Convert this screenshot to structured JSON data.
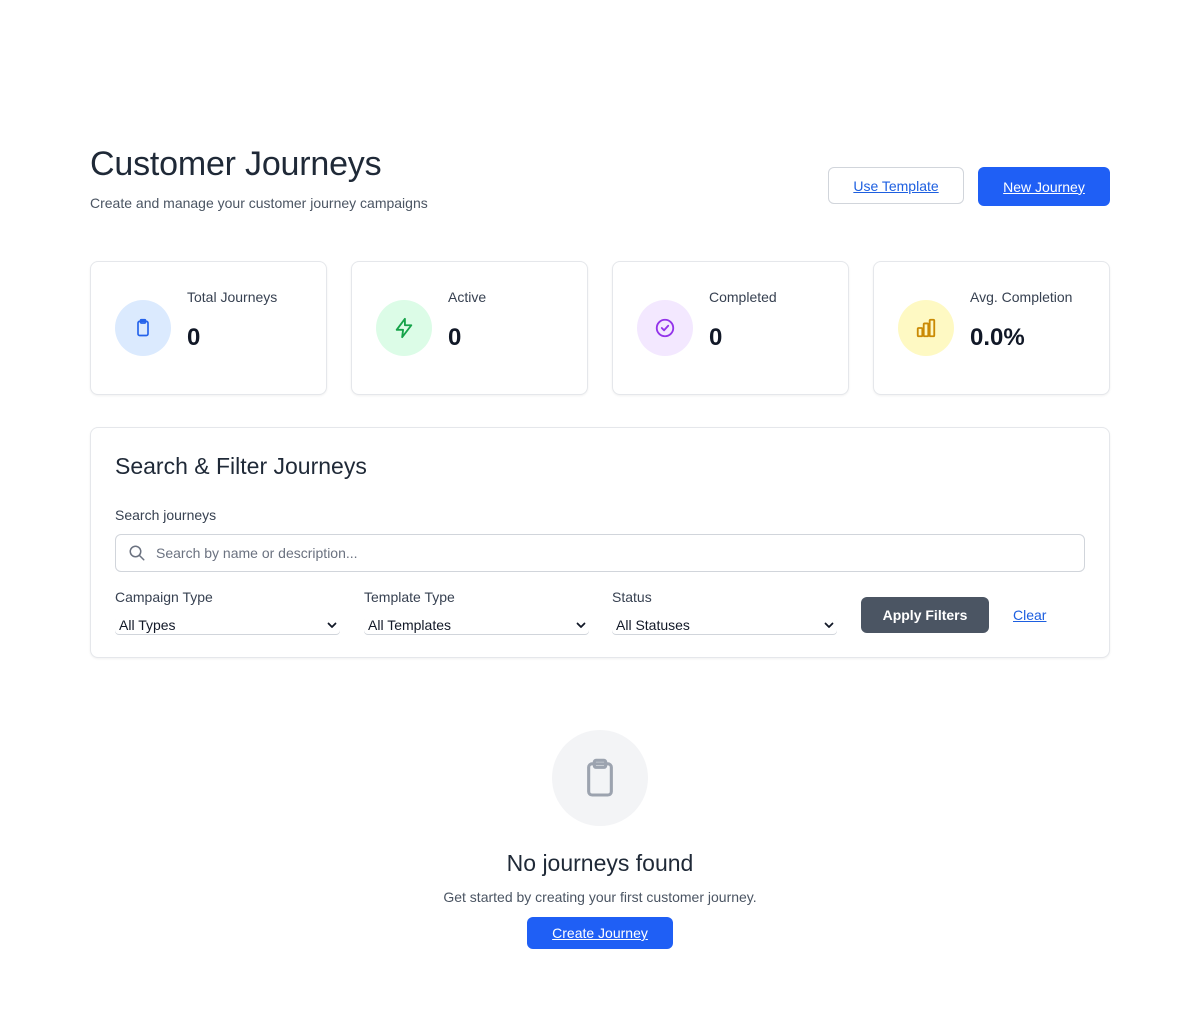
{
  "header": {
    "title": "Customer Journeys",
    "subtitle": "Create and manage your customer journey campaigns",
    "use_template_label": "Use Template",
    "new_journey_label": "New Journey"
  },
  "stats": [
    {
      "label": "Total Journeys",
      "value": "0",
      "icon": "clipboard-icon",
      "color": "#2563eb",
      "bg": "#dbeafe"
    },
    {
      "label": "Active",
      "value": "0",
      "icon": "lightning-icon",
      "color": "#16a34a",
      "bg": "#dcfce7"
    },
    {
      "label": "Completed",
      "value": "0",
      "icon": "check-circle-icon",
      "color": "#9333ea",
      "bg": "#f3e8ff"
    },
    {
      "label": "Avg. Completion",
      "value": "0.0%",
      "icon": "bar-chart-icon",
      "color": "#ca8a04",
      "bg": "#fef9c3"
    }
  ],
  "filters": {
    "title": "Search & Filter Journeys",
    "search_label": "Search journeys",
    "search_placeholder": "Search by name or description...",
    "campaign_type_label": "Campaign Type",
    "campaign_type_value": "All Types",
    "template_type_label": "Template Type",
    "template_type_value": "All Templates",
    "status_label": "Status",
    "status_value": "All Statuses",
    "apply_label": "Apply Filters",
    "clear_label": "Clear"
  },
  "empty_state": {
    "icon": "clipboard-icon",
    "title": "No journeys found",
    "text": "Get started by creating your first customer journey.",
    "button_label": "Create Journey"
  }
}
